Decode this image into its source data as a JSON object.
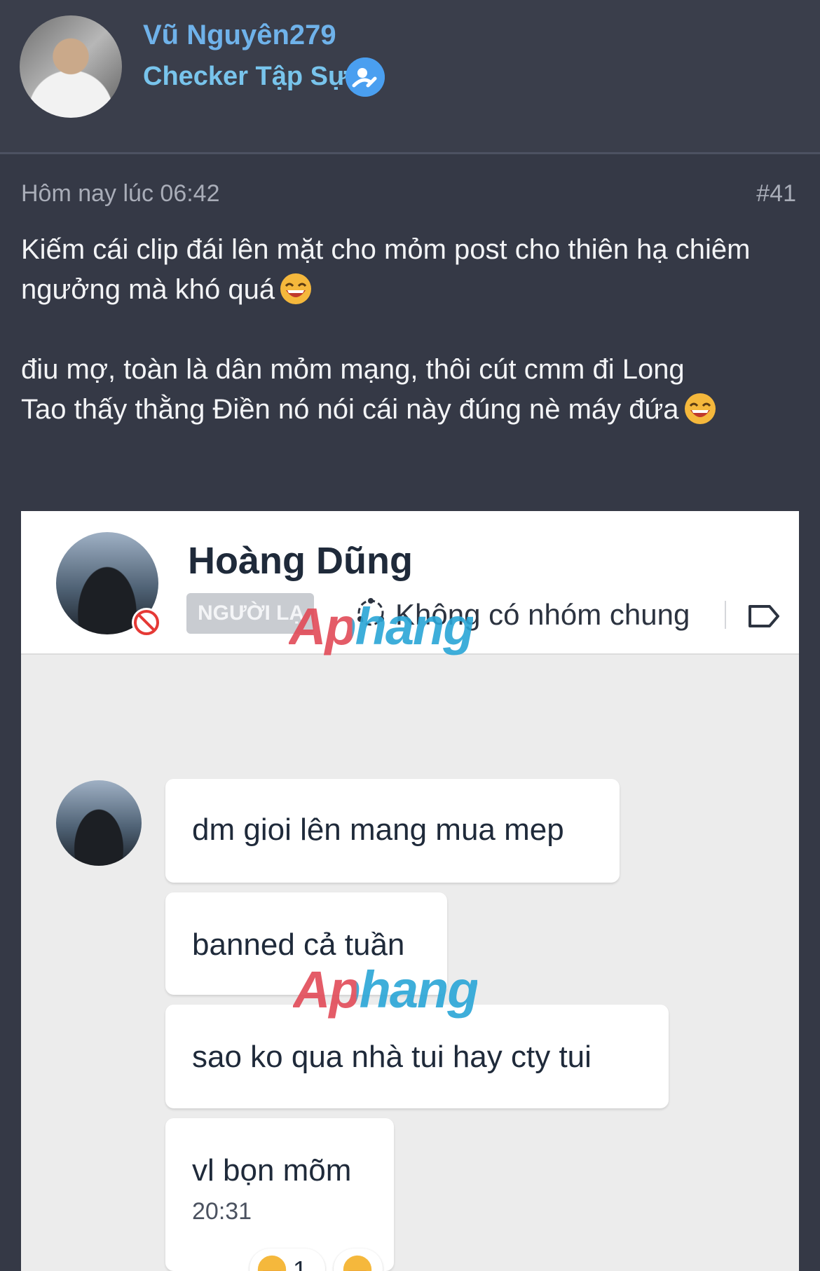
{
  "post": {
    "author": "Vũ Nguyên279",
    "author_title": "Checker Tập Sự",
    "time": "Hôm nay lúc 06:42",
    "number": "#41",
    "body_lines": [
      "Kiếm cái clip đái lên mặt cho mỏm post cho thiên hạ chiêm",
      "ngưởng mà khó quá",
      "điu mợ, toàn là dân mỏm mạng, thôi cút cmm đi Long",
      "Tao thấy thằng Điền nó nói cái này đúng nè máy đứa"
    ]
  },
  "attachment": {
    "contact_name": "Hoàng Dũng",
    "stranger_tag": "NGƯỜI LẠ",
    "no_common_groups": "Không có nhóm chung",
    "watermark": "Aphang",
    "messages": [
      "dm gioi lên mang mua mep",
      "banned cả tuần",
      "sao ko qua nhà tui hay cty tui",
      "vl bọn mõm"
    ],
    "last_message_time": "20:31",
    "reaction_count": "1"
  },
  "colors": {
    "page_bg": "#353946",
    "username": "#6fb2ea",
    "title": "#78c4ec",
    "badge": "#4a9ff0"
  },
  "icons": [
    "user-avatar",
    "verified-edit-icon",
    "laughing-emoji-icon",
    "blocked-icon",
    "group-icon",
    "tag-icon"
  ]
}
